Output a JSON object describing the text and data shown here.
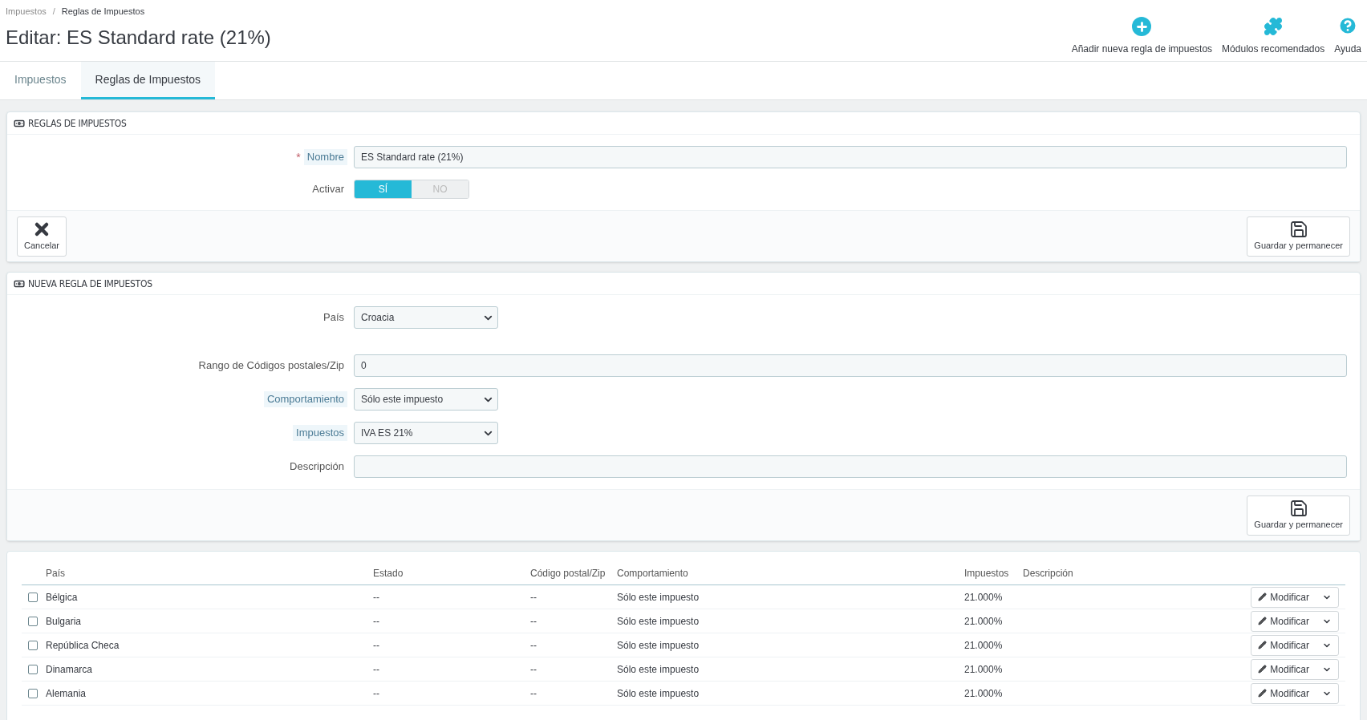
{
  "breadcrumb": {
    "items": [
      "Impuestos",
      "Reglas de Impuestos"
    ],
    "separator": "/"
  },
  "title": "Editar: ES Standard rate (21%)",
  "toolbar": [
    {
      "label": "Añadir nueva regla de impuestos"
    },
    {
      "label": "Módulos recomendados"
    },
    {
      "label": "Ayuda"
    }
  ],
  "tabs": [
    {
      "label": "Impuestos",
      "selected": false
    },
    {
      "label": "Reglas de Impuestos",
      "selected": true
    }
  ],
  "panels": [
    {
      "heading": "REGLAS DE IMPUESTOS",
      "fields": [
        {
          "kind": "text",
          "label": "Nombre",
          "required_mark": "*",
          "hint": true,
          "value": "ES Standard rate (21%)"
        },
        {
          "kind": "switch",
          "label": "Activar",
          "hint": false,
          "options": [
            {
              "label": "SÍ",
              "selected": true
            },
            {
              "label": "NO",
              "selected": false
            }
          ]
        }
      ],
      "footer": [
        {
          "kind": "cancel",
          "label": "Cancelar"
        },
        {
          "kind": "save",
          "label": "Guardar y permanecer"
        }
      ]
    },
    {
      "heading": "NUEVA REGLA DE IMPUESTOS",
      "fields": [
        {
          "kind": "select",
          "label": "País",
          "hint": false,
          "value": "Croacia"
        },
        {
          "kind": "text",
          "label": "Rango de Códigos postales/Zip",
          "hint": false,
          "value": "0"
        },
        {
          "kind": "select",
          "label": "Comportamiento",
          "hint": true,
          "value": "Sólo este impuesto"
        },
        {
          "kind": "select",
          "label": "Impuestos",
          "hint": true,
          "value": "IVA ES 21%"
        },
        {
          "kind": "text",
          "label": "Descripción",
          "hint": false
        }
      ],
      "footer": [
        {
          "kind": "save",
          "label": "Guardar y permanecer"
        }
      ]
    }
  ],
  "table": {
    "columns": [
      "País",
      "Estado",
      "Código postal/Zip",
      "Comportamiento",
      "Impuestos",
      "Descripción"
    ],
    "rows": [
      {
        "checked": false,
        "cells": [
          "Bélgica",
          "--",
          "--",
          "Sólo este impuesto",
          "21.000%"
        ],
        "action": "Modificar"
      },
      {
        "checked": false,
        "cells": [
          "Bulgaria",
          "--",
          "--",
          "Sólo este impuesto",
          "21.000%"
        ],
        "action": "Modificar"
      },
      {
        "checked": false,
        "cells": [
          "República Checa",
          "--",
          "--",
          "Sólo este impuesto",
          "21.000%"
        ],
        "action": "Modificar"
      },
      {
        "checked": false,
        "cells": [
          "Dinamarca",
          "--",
          "--",
          "Sólo este impuesto",
          "21.000%"
        ],
        "action": "Modificar"
      },
      {
        "checked": false,
        "cells": [
          "Alemania",
          "--",
          "--",
          "Sólo este impuesto",
          "21.000%"
        ],
        "action": "Modificar"
      }
    ]
  }
}
